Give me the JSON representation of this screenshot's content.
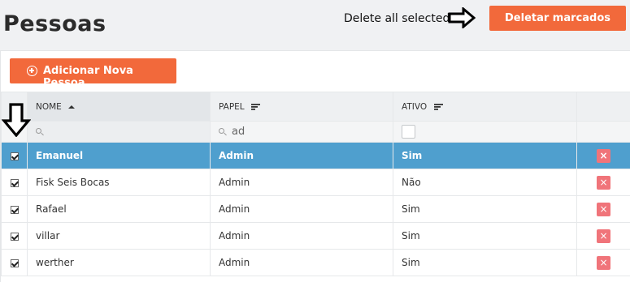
{
  "header": {
    "title": "Pessoas",
    "annotation": "Delete all selected",
    "delete_marked_label": "Deletar marcados"
  },
  "toolbar": {
    "add_person_label": "Adicionar Nova Pessoa"
  },
  "table": {
    "columns": [
      "NOME",
      "PAPEL",
      "ATIVO"
    ],
    "sort": {
      "column": "NOME",
      "direction": "ascending"
    },
    "filters": {
      "nome": "",
      "papel": "ad",
      "ativo": ""
    },
    "rows": [
      {
        "nome": "Emanuel",
        "papel": "Admin",
        "ativo": "Sim",
        "checked": true,
        "selected": true
      },
      {
        "nome": "Fisk Seis Bocas",
        "papel": "Admin",
        "ativo": "Não",
        "checked": true,
        "selected": false
      },
      {
        "nome": "Rafael",
        "papel": "Admin",
        "ativo": "Sim",
        "checked": true,
        "selected": false
      },
      {
        "nome": "villar",
        "papel": "Admin",
        "ativo": "Sim",
        "checked": true,
        "selected": false
      },
      {
        "nome": "werther",
        "papel": "Admin",
        "ativo": "Sim",
        "checked": true,
        "selected": false
      }
    ],
    "delete_glyph": "×"
  },
  "colors": {
    "accent": "#f2693b",
    "selected_row": "#4f9fce",
    "delete_button": "#f0747a"
  }
}
